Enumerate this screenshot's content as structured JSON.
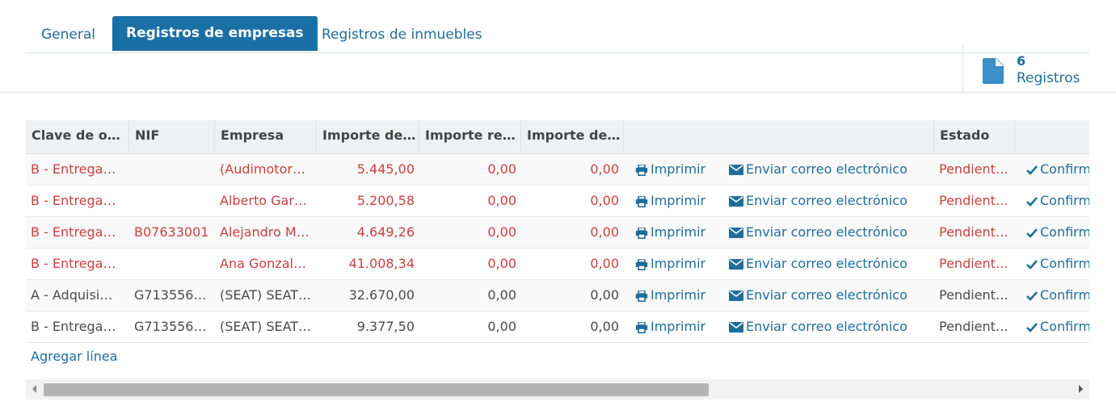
{
  "tabs": [
    {
      "label": "General"
    },
    {
      "label": "Registros de empresas"
    },
    {
      "label": "Registros de inmuebles"
    }
  ],
  "stat": {
    "count": "6",
    "label": "Registros"
  },
  "table": {
    "headers": [
      "Clave de o…",
      "NIF",
      "Empresa",
      "Importe de…",
      "Importe re…",
      "Importe de…",
      "",
      "Estado",
      ""
    ],
    "rows": [
      {
        "clave": "B - Entrega…",
        "nif": "",
        "empresa": "(Audimotor…",
        "imp1": "5.445,00",
        "imp2": "0,00",
        "imp3": "0,00",
        "estado": "Pendient…",
        "tone": "red"
      },
      {
        "clave": "B - Entrega…",
        "nif": "",
        "empresa": "Alberto Gar…",
        "imp1": "5.200,58",
        "imp2": "0,00",
        "imp3": "0,00",
        "estado": "Pendient…",
        "tone": "red"
      },
      {
        "clave": "B - Entrega…",
        "nif": "B07633001",
        "empresa": "Alejandro M…",
        "imp1": "4.649,26",
        "imp2": "0,00",
        "imp3": "0,00",
        "estado": "Pendient…",
        "tone": "red"
      },
      {
        "clave": "B - Entrega…",
        "nif": "",
        "empresa": "Ana Gonzal…",
        "imp1": "41.008,34",
        "imp2": "0,00",
        "imp3": "0,00",
        "estado": "Pendient…",
        "tone": "red"
      },
      {
        "clave": "A - Adquisi…",
        "nif": "G7135565…",
        "empresa": "(SEAT) SEAT…",
        "imp1": "32.670,00",
        "imp2": "0,00",
        "imp3": "0,00",
        "estado": "Pendient…",
        "tone": "dark"
      },
      {
        "clave": "B - Entrega…",
        "nif": "G7135565…",
        "empresa": "(SEAT) SEAT…",
        "imp1": "9.377,50",
        "imp2": "0,00",
        "imp3": "0,00",
        "estado": "Pendient…",
        "tone": "dark"
      }
    ],
    "actions": {
      "print": "Imprimir",
      "email": "Enviar correo electrónico",
      "confirm": "Confirm"
    },
    "add_line": "Agregar línea"
  },
  "icons": {
    "stat": "document-icon",
    "print": "printer-icon",
    "email": "envelope-icon",
    "confirm": "check-icon"
  },
  "colors": {
    "accent": "#1a6fa5",
    "link": "#1f6d9a",
    "warning_text": "#c9403f",
    "header_bg": "#eef0f2"
  }
}
